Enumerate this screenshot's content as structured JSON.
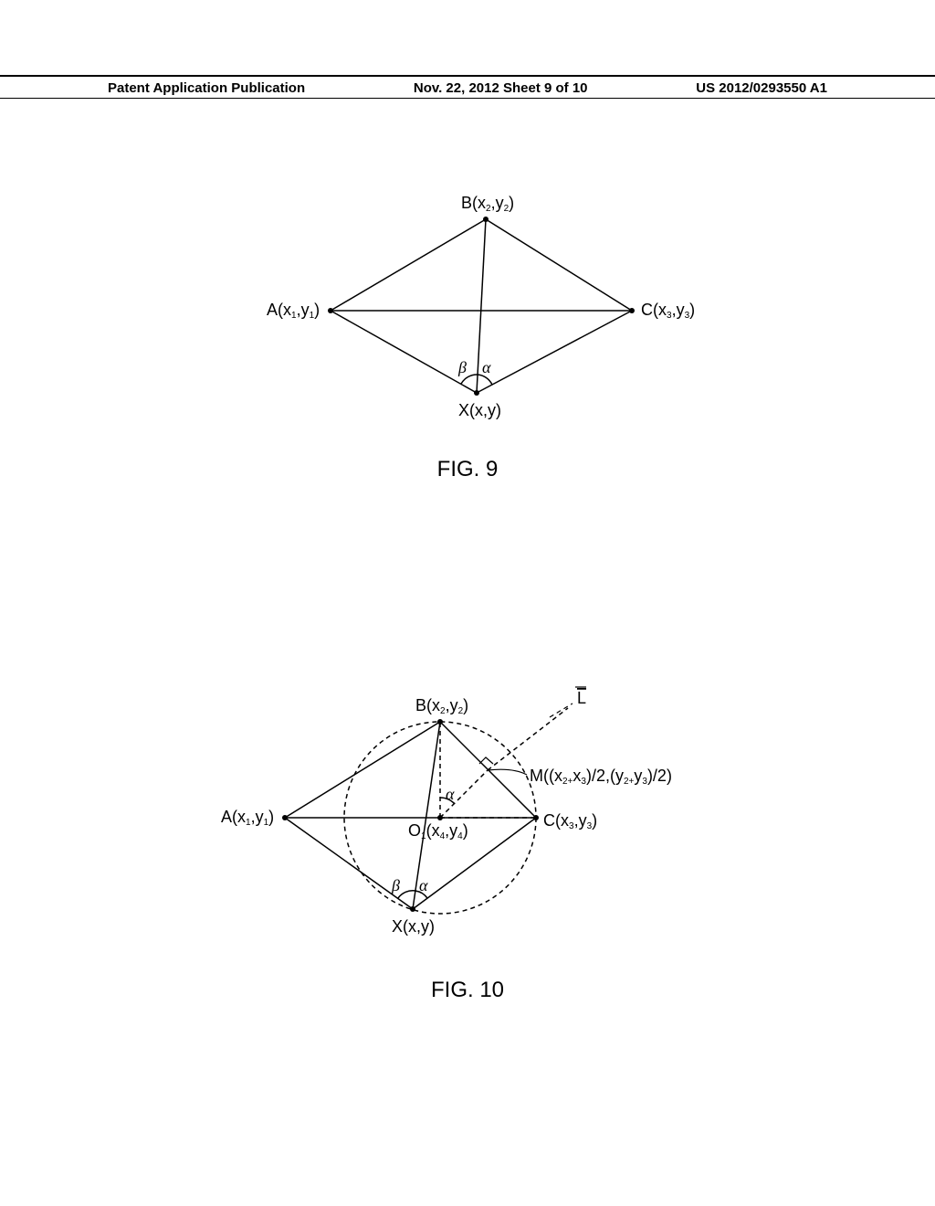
{
  "header": {
    "left": "Patent Application Publication",
    "center": "Nov. 22, 2012  Sheet 9 of 10",
    "right": "US 2012/0293550 A1"
  },
  "fig9": {
    "caption": "FIG. 9",
    "points": {
      "A": {
        "label": "A(x₁,y₁)"
      },
      "B": {
        "label": "B(x₂,y₂)"
      },
      "C": {
        "label": "C(x₃,y₃)"
      },
      "X": {
        "label": "X(x,y)"
      }
    },
    "angles": {
      "beta": "β",
      "alpha": "α"
    }
  },
  "fig10": {
    "caption": "FIG. 10",
    "points": {
      "A": {
        "label": "A(x₁,y₁)"
      },
      "B": {
        "label": "B(x₂,y₂)"
      },
      "C": {
        "label": "C(x₃,y₃)"
      },
      "X": {
        "label": "X(x,y)"
      },
      "O1": {
        "label": "O₁(x₄,y₄)"
      },
      "M": {
        "label": "M((x₂₊x₃)/2,(y₂₊y₃)/2)"
      },
      "L": {
        "label": "L"
      }
    },
    "angles": {
      "beta": "β",
      "alpha": "α",
      "alpha2": "α"
    }
  }
}
